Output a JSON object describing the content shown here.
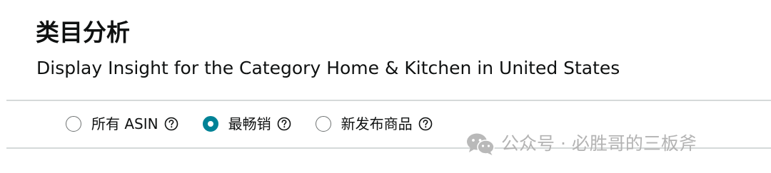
{
  "header": {
    "title": "类目分析",
    "subtitle": "Display Insight for the Category Home & Kitchen in United States"
  },
  "filters": {
    "options": [
      {
        "label": "所有 ASIN",
        "selected": false
      },
      {
        "label": "最畅销",
        "selected": true
      },
      {
        "label": "新发布商品",
        "selected": false
      }
    ],
    "accent_color": "#008296"
  },
  "watermark": {
    "text": "公众号 · 必胜哥的三板斧",
    "icon": "wechat-icon"
  }
}
